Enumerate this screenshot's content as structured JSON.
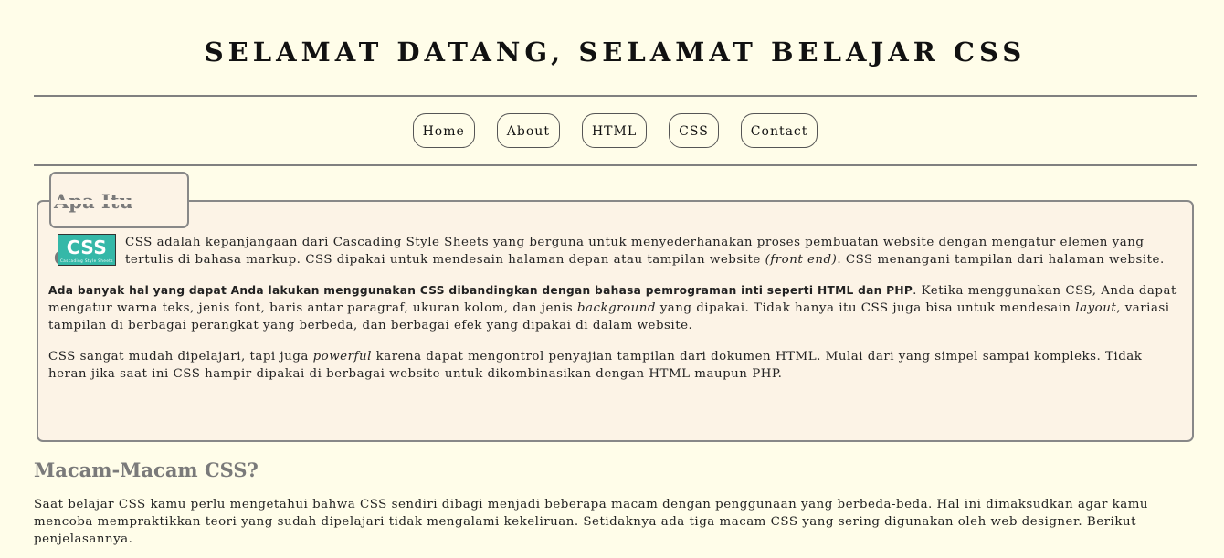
{
  "header": {
    "title": "SELAMAT DATANG, SELAMAT BELAJAR CSS"
  },
  "nav": {
    "items": [
      {
        "label": "Home"
      },
      {
        "label": "About"
      },
      {
        "label": "HTML"
      },
      {
        "label": "CSS"
      },
      {
        "label": "Contact"
      }
    ]
  },
  "section1": {
    "legend": "Apa Itu CSS?",
    "logo": {
      "text": "CSS",
      "subtext": "Cascading Style Sheets",
      "color": "#35b8a8"
    },
    "p1": {
      "before_link": "CSS adalah kepanjangaan dari ",
      "link": "Cascading Style Sheets",
      "after_link": " yang berguna untuk menyederhanakan proses pembuatan website dengan mengatur elemen yang tertulis di bahasa markup. CSS dipakai untuk mendesain halaman depan atau tampilan website ",
      "em": "(front end)",
      "end": ". CSS menangani tampilan dari halaman website."
    },
    "p2": {
      "bold": "Ada banyak hal yang dapat Anda lakukan menggunakan CSS dibandingkan dengan bahasa pemrograman inti seperti HTML dan PHP",
      "text1": ". Ketika menggunakan CSS, Anda dapat mengatur warna teks, jenis font, baris antar paragraf, ukuran kolom, dan jenis ",
      "em1": "background",
      "text2": " yang dipakai. Tidak hanya itu CSS juga bisa untuk mendesain ",
      "em2": "layout",
      "text3": ", variasi tampilan di berbagai perangkat yang berbeda, dan berbagai efek yang dipakai di dalam website."
    },
    "p3": {
      "text1": "CSS sangat mudah dipelajari, tapi juga ",
      "em": "powerful",
      "text2": " karena dapat mengontrol penyajian tampilan dari dokumen HTML. Mulai dari yang simpel sampai kompleks. Tidak heran jika saat ini CSS hampir dipakai di berbagai website untuk dikombinasikan dengan HTML maupun PHP."
    }
  },
  "section2": {
    "title": "Macam-Macam CSS?",
    "text": "Saat belajar CSS kamu perlu mengetahui bahwa CSS sendiri dibagi menjadi beberapa macam dengan penggunaan yang berbeda-beda. Hal ini dimaksudkan agar kamu mencoba mempraktikkan teori yang sudah dipelajari tidak mengalami kekeliruan. Setidaknya ada tiga macam CSS yang sering digunakan oleh web designer. Berikut penjelasannya."
  },
  "colors": {
    "background": "#fffde9",
    "box_background": "#fcf3e6",
    "heading_gray": "#7a7a7a",
    "rule": "#808080"
  }
}
